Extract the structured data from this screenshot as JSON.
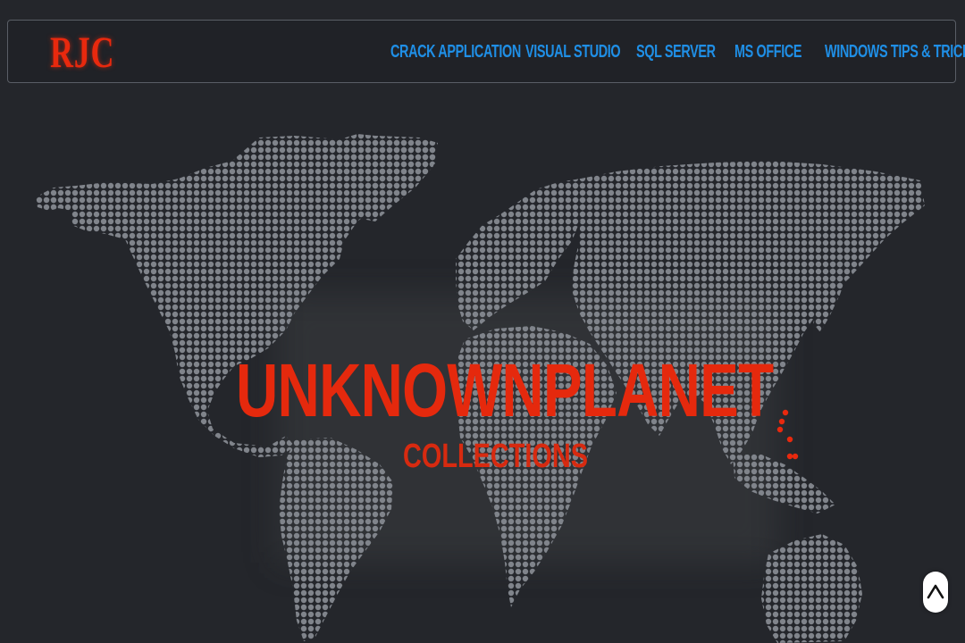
{
  "brand": {
    "logo_text": "RJC"
  },
  "nav": {
    "items": [
      {
        "label": "CRACK APPLICATION"
      },
      {
        "label": "VISUAL STUDIO"
      },
      {
        "label": "SQL SERVER"
      },
      {
        "label": "MS OFFICE"
      },
      {
        "label": "WINDOWS TIPS & TRICKS"
      }
    ]
  },
  "hero": {
    "title": "UNKNOWNPLANET",
    "subtitle": "COLLECTIONS",
    "background": "dotted-world-map"
  },
  "scroll_top": {
    "icon": "chevron-up-icon"
  },
  "colors": {
    "background": "#24262b",
    "brand": "#e8290e",
    "nav_link": "#1f8fe6",
    "map_dots": "#7b7f86",
    "hero_text": "#e5290d"
  }
}
